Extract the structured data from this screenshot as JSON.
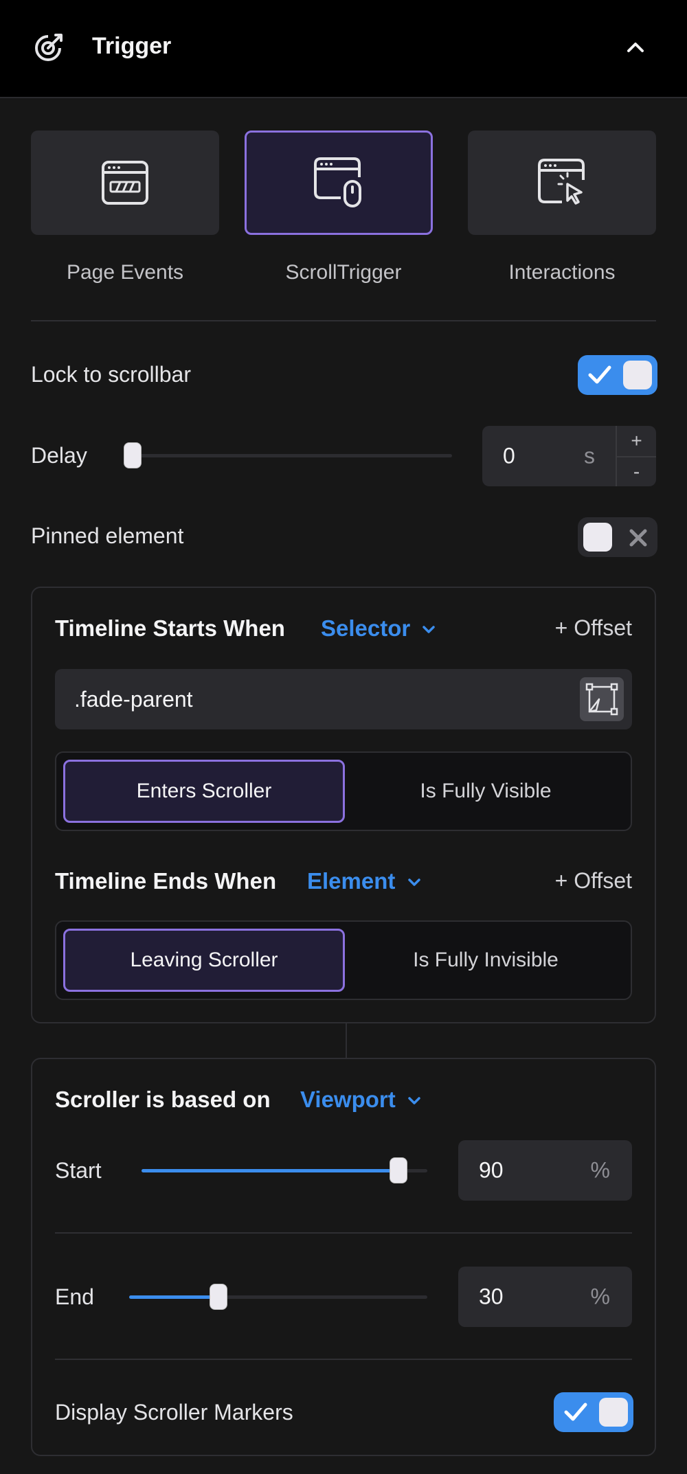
{
  "header": {
    "title": "Trigger"
  },
  "tabs": [
    {
      "label": "Page Events",
      "icon": "page-events-icon",
      "active": false
    },
    {
      "label": "ScrollTrigger",
      "icon": "scroll-trigger-icon",
      "active": true
    },
    {
      "label": "Interactions",
      "icon": "interactions-icon",
      "active": false
    }
  ],
  "lock_to_scrollbar": {
    "label": "Lock to scrollbar",
    "on": true
  },
  "delay": {
    "label": "Delay",
    "value": "0",
    "unit": "s",
    "plus": "+",
    "minus": "-"
  },
  "pinned_element": {
    "label": "Pinned element",
    "on": false
  },
  "timeline_start": {
    "label": "Timeline Starts When",
    "mode": "Selector",
    "offset_label": "+ Offset",
    "selector_value": ".fade-parent",
    "options": [
      "Enters Scroller",
      "Is Fully Visible"
    ],
    "selected": "Enters Scroller"
  },
  "timeline_end": {
    "label": "Timeline Ends When",
    "mode": "Element",
    "offset_label": "+ Offset",
    "options": [
      "Leaving Scroller",
      "Is Fully Invisible"
    ],
    "selected": "Leaving Scroller"
  },
  "scroller": {
    "label": "Scroller is based on",
    "mode": "Viewport",
    "start": {
      "label": "Start",
      "value": "90",
      "unit": "%"
    },
    "end": {
      "label": "End",
      "value": "30",
      "unit": "%"
    },
    "markers": {
      "label": "Display Scroller Markers",
      "on": true
    }
  },
  "colors": {
    "accent_blue": "#3b8ded",
    "accent_purple": "#8b71df",
    "background": "#171717"
  }
}
